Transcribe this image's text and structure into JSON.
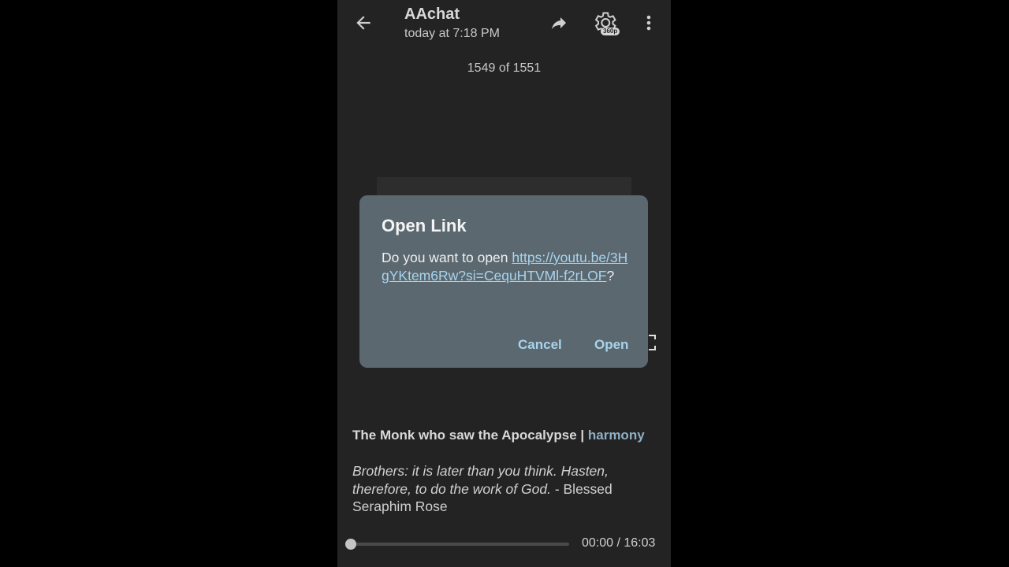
{
  "header": {
    "title": "AAchat",
    "subtitle": "today at 7:18 PM",
    "quality_badge": "360p",
    "icons": [
      "back-arrow-icon",
      "share-icon",
      "settings-gear-icon",
      "more-vert-icon"
    ]
  },
  "counter": "1549 of 1551",
  "dialog": {
    "title": "Open Link",
    "prompt": "Do you want to open ",
    "url": "https://youtu.be/3HgYKtem6Rw?si=CequHTVMl-f2rLOF",
    "suffix": "?",
    "cancel_label": "Cancel",
    "open_label": "Open"
  },
  "post": {
    "title": "The Monk who saw the Apocalypse",
    "separator": " | ",
    "tag": "harmony",
    "quote_italic": "Brothers: it is later than you think. Hasten, therefore, to do the work of God.",
    "quote_attribution": " - Blessed Seraphim Rose"
  },
  "player": {
    "current_time": "00:00",
    "duration": "16:03",
    "time_display": "00:00 / 16:03",
    "progress_fraction": 0.0
  },
  "colors": {
    "background": "#232323",
    "dialog": "#5b6870",
    "link": "#a8d4ec",
    "tag": "#8fb0c6"
  }
}
